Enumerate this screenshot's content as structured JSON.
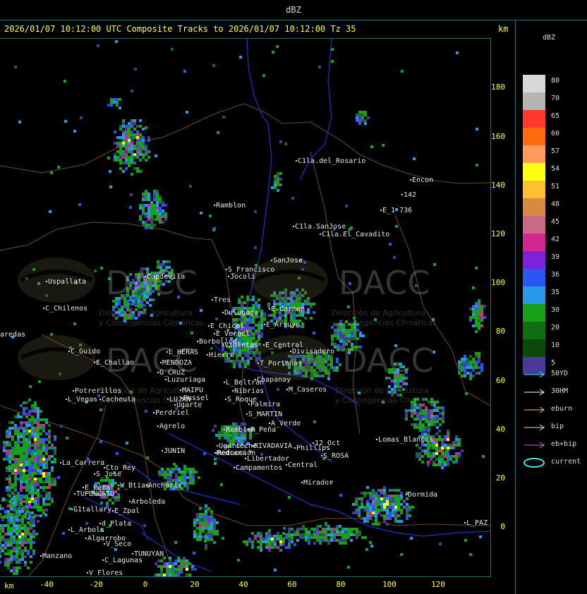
{
  "window": {
    "title": "dBZ"
  },
  "header": {
    "text": "2026/01/07 10:12:00 UTC Composite Tracks to 2026/01/07 10:12:00 Tz 35",
    "km_label_top": "km",
    "km_label_bottom": "km"
  },
  "x_ticks": [
    "-40",
    "-20",
    "0",
    "20",
    "40",
    "60",
    "80",
    "100",
    "120"
  ],
  "y_ticks": [
    "180",
    "160",
    "140",
    "120",
    "100",
    "80",
    "60",
    "40",
    "20",
    "0"
  ],
  "legend": {
    "title": "dBZ",
    "scale": [
      {
        "label": "80",
        "color": "#d8d8d8"
      },
      {
        "label": "70",
        "color": "#b4b4b4"
      },
      {
        "label": "65",
        "color": "#ff3a2a"
      },
      {
        "label": "60",
        "color": "#ff6a10"
      },
      {
        "label": "57",
        "color": "#ff9a5a"
      },
      {
        "label": "54",
        "color": "#ffff10"
      },
      {
        "label": "51",
        "color": "#ffc030"
      },
      {
        "label": "48",
        "color": "#d88a40"
      },
      {
        "label": "45",
        "color": "#c86a88"
      },
      {
        "label": "42",
        "color": "#d02890"
      },
      {
        "label": "39",
        "color": "#8020d8"
      },
      {
        "label": "36",
        "color": "#2858f0"
      },
      {
        "label": "35",
        "color": "#2898e8"
      },
      {
        "label": "30",
        "color": "#18a018"
      },
      {
        "label": "20",
        "color": "#107010"
      },
      {
        "label": "10",
        "color": "#0a4a0a"
      },
      {
        "label": "5",
        "color": "#4a3a98"
      }
    ],
    "tracks": [
      {
        "label": "50YD",
        "color": "#40e8e8",
        "shape": "arrow"
      },
      {
        "label": "30HM",
        "color": "#ffffff",
        "shape": "arrow"
      },
      {
        "label": "eburn",
        "color": "#f0c080",
        "shape": "arrow"
      },
      {
        "label": "bip",
        "color": "#f8d0d8",
        "shape": "arrow"
      },
      {
        "label": "eb+bip",
        "color": "#e060e0",
        "shape": "arrow"
      },
      {
        "label": "current",
        "color": "#40e8e8",
        "shape": "ellipse"
      }
    ]
  },
  "watermark": {
    "brand": "DACC",
    "line1": "Dirección de Agricultura",
    "line2": "y Contingencias Climáticas"
  },
  "places": [
    {
      "name": "C1la.del_Rosario"
    },
    {
      "name": "Encon"
    },
    {
      "name": "142"
    },
    {
      "name": "E_1-736"
    },
    {
      "name": "Ramblon"
    },
    {
      "name": "C1la.SanJose"
    },
    {
      "name": "C1la.El_Cavadito"
    },
    {
      "name": "Uspallata"
    },
    {
      "name": "C_Chilenos"
    },
    {
      "name": "aredas"
    },
    {
      "name": "Capdevila"
    },
    {
      "name": "S_Francisco"
    },
    {
      "name": "Jocoli"
    },
    {
      "name": "SanJose"
    },
    {
      "name": "Tres"
    },
    {
      "name": "Dulugaga"
    },
    {
      "name": "E_Carmen"
    },
    {
      "name": "E_Arsuyo"
    },
    {
      "name": "E_Chical"
    },
    {
      "name": "E_Vergel"
    },
    {
      "name": "Borbollon"
    },
    {
      "name": "Violetas"
    },
    {
      "name": "E_Central"
    },
    {
      "name": "Divisadero"
    },
    {
      "name": "C_Guido"
    },
    {
      "name": "L_HERAS"
    },
    {
      "name": "Hierro"
    },
    {
      "name": "E_Challao"
    },
    {
      "name": "MENDOZA"
    },
    {
      "name": "G_CRUZ"
    },
    {
      "name": "Luzuriaga"
    },
    {
      "name": "T_Porteñas"
    },
    {
      "name": "L_Beltran"
    },
    {
      "name": "Chapanay"
    },
    {
      "name": "Potrerillos"
    },
    {
      "name": "L_Vegas"
    },
    {
      "name": "Cacheuta"
    },
    {
      "name": "MAIPU"
    },
    {
      "name": "Russel"
    },
    {
      "name": "LUJAN"
    },
    {
      "name": "Ugarte"
    },
    {
      "name": "Nibrías"
    },
    {
      "name": "M_Caseros"
    },
    {
      "name": "S_Roque"
    },
    {
      "name": "Palmira"
    },
    {
      "name": "Perdriel"
    },
    {
      "name": "S_MARTIN"
    },
    {
      "name": "A_Verde"
    },
    {
      "name": "Agrelo"
    },
    {
      "name": "Ramblon"
    },
    {
      "name": "R_Peña"
    },
    {
      "name": "JUNIN"
    },
    {
      "name": "Ugarteche"
    },
    {
      "name": "Medrano"
    },
    {
      "name": "RIVADAVIA"
    },
    {
      "name": "12_Oct"
    },
    {
      "name": "Phillips"
    },
    {
      "name": "Reducción"
    },
    {
      "name": "Libertador"
    },
    {
      "name": "S_ROSA"
    },
    {
      "name": "La_Carrera"
    },
    {
      "name": "Cto_Rey"
    },
    {
      "name": "S_Jose"
    },
    {
      "name": "Campamentos"
    },
    {
      "name": "Central"
    },
    {
      "name": "Lomas_Blancas"
    },
    {
      "name": "E_Peral"
    },
    {
      "name": "W_Btias"
    },
    {
      "name": "Anchoris"
    },
    {
      "name": "Mirador"
    },
    {
      "name": "TUPUNGATO"
    },
    {
      "name": "Arboleda"
    },
    {
      "name": "Dormida"
    },
    {
      "name": "G1tallary"
    },
    {
      "name": "E_Zpal"
    },
    {
      "name": "d_Plata"
    },
    {
      "name": "L_Arbols"
    },
    {
      "name": "Algarrobo"
    },
    {
      "name": "L_PAZ"
    },
    {
      "name": "V_Seco"
    },
    {
      "name": "TUNUYAN"
    },
    {
      "name": "Manzano"
    },
    {
      "name": "C_Lagunas"
    },
    {
      "name": "V_Flores"
    }
  ]
}
